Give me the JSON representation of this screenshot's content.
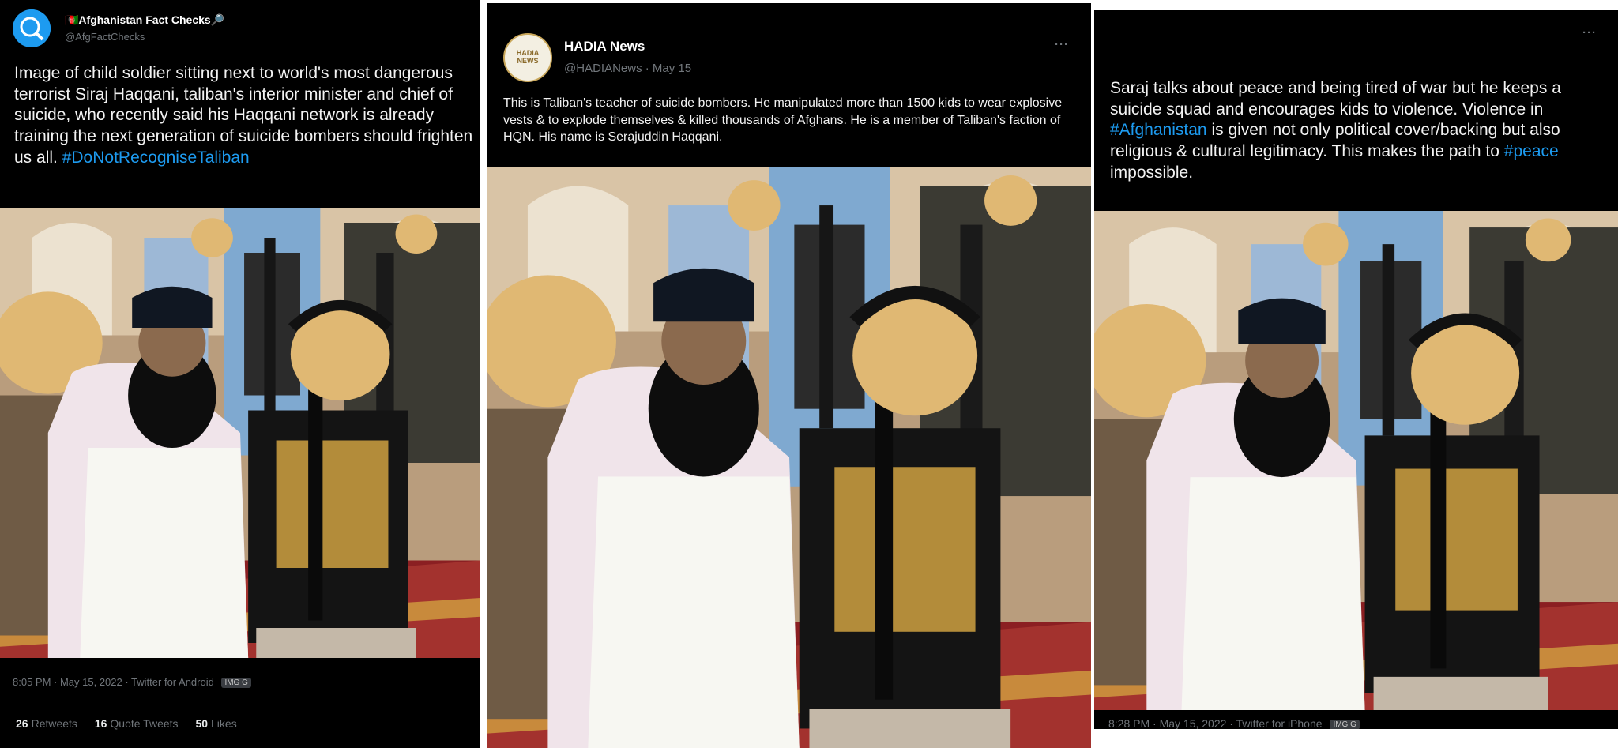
{
  "panels": [
    {
      "author_name": "🇦🇫Afghanistan Fact Checks🔎",
      "author_handle": "@AfgFactChecks",
      "text": "Image of child soldier sitting next to world's most dangerous terrorist Siraj Haqqani, taliban's interior minister and chief of suicide, who recently said his Haqqani network is already training the next generation of suicide bombers should frighten us all.",
      "hashtag": "#DoNotRecogniseTaliban",
      "timestamp": "8:05 PM · May 15, 2022 · Twitter for Android",
      "img_badge": "IMG G",
      "stats": {
        "retweets_count": "26",
        "retweets_label": "Retweets",
        "quotes_count": "16",
        "quotes_label": "Quote Tweets",
        "likes_count": "50",
        "likes_label": "Likes"
      }
    },
    {
      "author_name": "HADIA News",
      "author_handle": "@HADIANews · May 15",
      "avatar_text": "HADIA NEWS",
      "text": "This is Taliban's teacher of suicide bombers. He manipulated more than 1500 kids to wear explosive vests & to explode themselves & killed thousands of Afghans. He is a member of Taliban's faction of HQN. His name is Serajuddin Haqqani.",
      "more": "···"
    },
    {
      "text_before": "Saraj talks about peace and being tired of war but he keeps a suicide squad and encourages kids to violence. Violence in ",
      "hashtag1": "#Afghanistan",
      "text_middle": " is given not only political cover/backing but also religious & cultural legitimacy. This makes the path to ",
      "hashtag2": "#peace",
      "text_after": " impossible.",
      "more": "···",
      "timestamp": "8:28 PM · May 15, 2022 · Twitter for iPhone",
      "img_badge": "IMG G"
    }
  ],
  "colors": {
    "panel_bg": "#000000",
    "text": "#e7e9ea",
    "muted": "#71767b",
    "link": "#1d9bf0",
    "avatar_afg": "#1d9bf0",
    "avatar_hadia": "#f3efe2"
  }
}
